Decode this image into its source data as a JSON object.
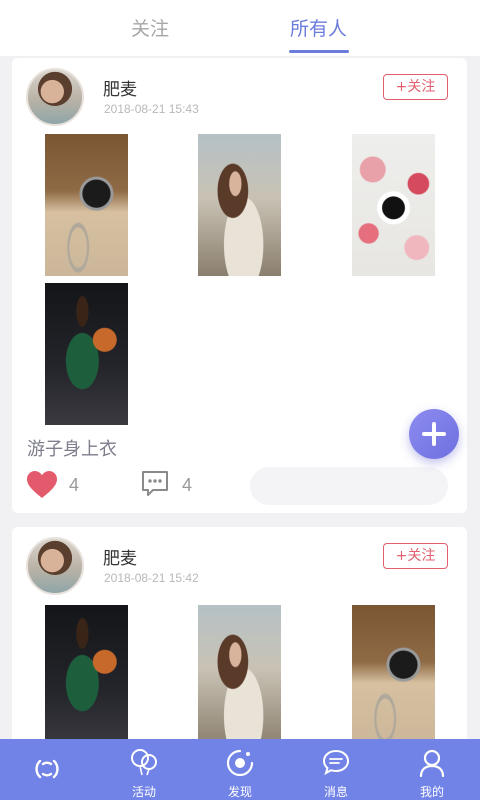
{
  "tabs": {
    "follow": "关注",
    "all": "所有人",
    "active": "all"
  },
  "posts": [
    {
      "author": "肥麦",
      "time": "2018-08-21 15:43",
      "follow_label": "+关注",
      "photos": [
        "pocket-watch",
        "woman-floral-dress",
        "coffee-flowers",
        "basketball-player"
      ],
      "caption": "游子身上衣",
      "likes": "4",
      "comments": "4"
    },
    {
      "author": "肥麦",
      "time": "2018-08-21 15:42",
      "follow_label": "+关注",
      "photos": [
        "basketball-player",
        "woman-floral-dress",
        "pocket-watch"
      ]
    }
  ],
  "nav": {
    "items": [
      {
        "icon": "circle-logo-icon",
        "label": ""
      },
      {
        "icon": "balloons-icon",
        "label": "活动"
      },
      {
        "icon": "discover-eye-icon",
        "label": "发现"
      },
      {
        "icon": "chat-bubble-icon",
        "label": "消息"
      },
      {
        "icon": "person-icon",
        "label": "我的"
      }
    ]
  },
  "colors": {
    "accent": "#6b7cdc",
    "nav_bg": "#7183e6",
    "follow_red": "#e15f6f",
    "heart": "#e35a6c"
  }
}
